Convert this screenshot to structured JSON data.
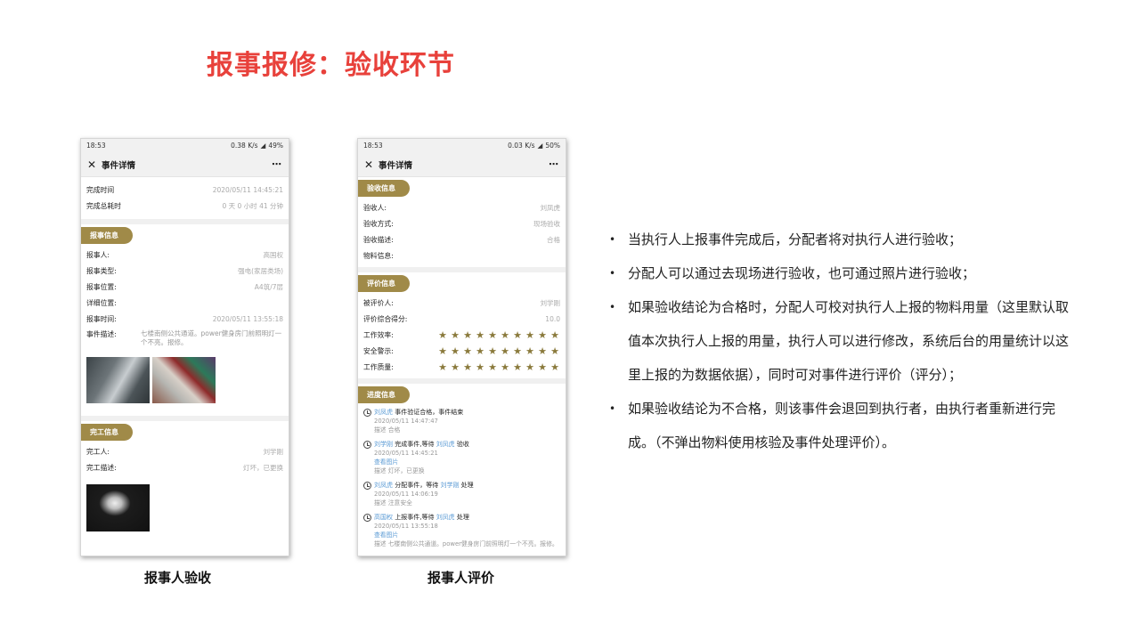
{
  "title": "报事报修：验收环节",
  "phone1": {
    "status": {
      "time": "18:53",
      "net": "0.38 K/s",
      "battery": "49%"
    },
    "appbar": {
      "close": "✕",
      "title": "事件详情",
      "more": "⋯"
    },
    "top_rows": [
      {
        "k": "完成时间",
        "v": "2020/05/11 14:45:21"
      },
      {
        "k": "完成总耗时",
        "v": "0 天 0 小时 41 分钟"
      }
    ],
    "report": {
      "header": "报事信息",
      "rows": [
        {
          "k": "报事人:",
          "v": "高国权"
        },
        {
          "k": "报事类型:",
          "v": "强电(家居类场)"
        },
        {
          "k": "报事位置:",
          "v": "A4筑/7层"
        },
        {
          "k": "详细位置:",
          "v": ""
        },
        {
          "k": "报事时间:",
          "v": "2020/05/11 13:55:18"
        }
      ],
      "desc_k": "事件描述:",
      "desc_v": "七楼南侧公共通道。power健身房门前照明灯一个不亮。报修。"
    },
    "finish": {
      "header": "完工信息",
      "rows": [
        {
          "k": "完工人:",
          "v": "刘学刚"
        },
        {
          "k": "完工描述:",
          "v": "灯坏，已更换"
        }
      ]
    }
  },
  "phone2": {
    "status": {
      "time": "18:53",
      "net": "0.03 K/s",
      "battery": "50%"
    },
    "appbar": {
      "close": "✕",
      "title": "事件详情",
      "more": "⋯"
    },
    "accept": {
      "header": "验收信息",
      "rows": [
        {
          "k": "验收人:",
          "v": "刘凤虎"
        },
        {
          "k": "验收方式:",
          "v": "现场验收"
        },
        {
          "k": "验收描述:",
          "v": "合格"
        },
        {
          "k": "物料信息:",
          "v": ""
        }
      ]
    },
    "eval": {
      "header": "评价信息",
      "rows": [
        {
          "k": "被评价人:",
          "v": "刘学刚"
        },
        {
          "k": "评价综合得分:",
          "v": "10.0"
        }
      ],
      "star_rows": [
        {
          "k": "工作效率:",
          "stars": 10
        },
        {
          "k": "安全警示:",
          "stars": 10
        },
        {
          "k": "工作质量:",
          "stars": 10
        }
      ]
    },
    "progress": {
      "header": "进度信息",
      "items": [
        {
          "who": "刘凤虎",
          "action": " 事件验证合格，事件结束",
          "time": "2020/05/11 14:47:47",
          "link": "",
          "desc": "描述 合格"
        },
        {
          "who": "刘学刚",
          "action": " 完成事件,等待 ",
          "who2": "刘凤虎",
          "action2": " 验收",
          "time": "2020/05/11 14:45:21",
          "link": "查看图片",
          "desc": "描述 灯坏，已更换"
        },
        {
          "who": "刘凤虎",
          "action": " 分配事件，等待 ",
          "who2": "刘学刚",
          "action2": " 处理",
          "time": "2020/05/11 14:06:19",
          "link": "",
          "desc": "描述 注意安全"
        },
        {
          "who": "高国权",
          "action": " 上报事件,等待 ",
          "who2": "刘凤虎",
          "action2": " 处理",
          "time": "2020/05/11 13:55:18",
          "link": "查看图片",
          "desc": "描述 七楼南侧公共通道。power健身房门前照明灯一个不亮。报修。"
        }
      ]
    }
  },
  "captions": {
    "left": "报事人验收",
    "right": "报事人评价"
  },
  "bullets": [
    "当执行人上报事件完成后，分配者将对执行人进行验收；",
    "分配人可以通过去现场进行验收，也可通过照片进行验收；",
    "如果验收结论为合格时，分配人可校对执行人上报的物料用量（这里默认取值本次执行人上报的用量，执行人可以进行修改，系统后台的用量统计以这里上报的为数据依据），同时可对事件进行评价（评分）；",
    "如果验收结论为不合格，则该事件会退回到执行者，由执行者重新进行完成。（不弹出物料使用核验及事件处理评价）。"
  ]
}
